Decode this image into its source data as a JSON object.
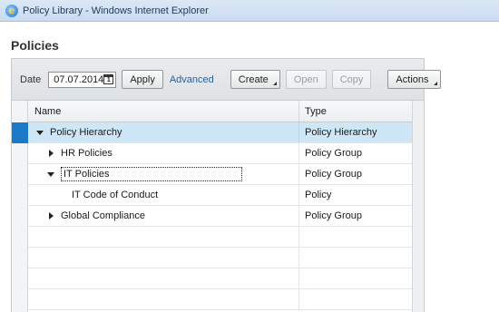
{
  "window": {
    "title": "Policy Library - Windows Internet Explorer"
  },
  "page": {
    "title": "Policies"
  },
  "toolbar": {
    "date_label": "Date",
    "date_value": "07.07.2014",
    "calendar_day": "1",
    "apply_label": "Apply",
    "advanced_label": "Advanced",
    "create_label": "Create",
    "open_label": "Open",
    "copy_label": "Copy",
    "actions_label": "Actions"
  },
  "table": {
    "columns": [
      "Name",
      "Type"
    ],
    "rows": [
      {
        "name": "Policy Hierarchy",
        "type": "Policy Hierarchy",
        "level": 0,
        "expanded": true,
        "selected": true
      },
      {
        "name": "HR Policies",
        "type": "Policy Group",
        "level": 1,
        "expanded": false
      },
      {
        "name": "IT Policies",
        "type": "Policy Group",
        "level": 1,
        "expanded": true,
        "focused": true
      },
      {
        "name": "IT Code of Conduct",
        "type": "Policy",
        "level": 2,
        "leaf": true
      },
      {
        "name": "Global Compliance",
        "type": "Policy Group",
        "level": 1,
        "expanded": false
      }
    ]
  },
  "colors": {
    "selected_row": "#cfe6f6",
    "selection_marker": "#1c7ac8",
    "link": "#2a5f9e"
  }
}
